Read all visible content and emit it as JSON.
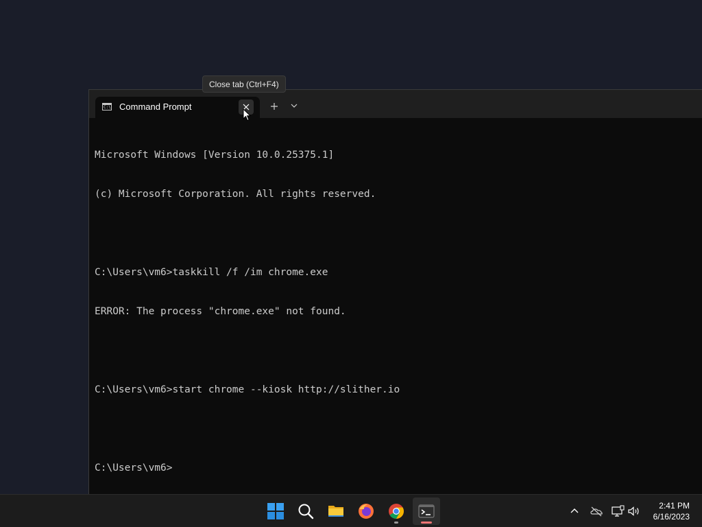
{
  "window": {
    "tab_title": "Command Prompt",
    "tab_icon": "cmd-icon",
    "close_tab_icon": "close-icon",
    "new_tab_icon": "plus-icon",
    "dropdown_icon": "chevron-down-icon"
  },
  "tooltip": {
    "text": "Close tab (Ctrl+F4)"
  },
  "console": {
    "lines": [
      "Microsoft Windows [Version 10.0.25375.1]",
      "(c) Microsoft Corporation. All rights reserved.",
      "",
      "C:\\Users\\vm6>taskkill /f /im chrome.exe",
      "ERROR: The process \"chrome.exe\" not found.",
      "",
      "C:\\Users\\vm6>start chrome --kiosk http://slither.io",
      "",
      "C:\\Users\\vm6>"
    ]
  },
  "taskbar": {
    "apps": [
      "start-icon",
      "search-icon",
      "file-explorer-icon",
      "firefox-icon",
      "chrome-icon",
      "terminal-icon"
    ],
    "tray": [
      "chevron-up-icon",
      "onedrive-icon",
      "network-icon",
      "volume-icon"
    ],
    "time": "2:41 PM",
    "date": "6/16/2023"
  },
  "colors": {
    "desktop": "#1a1d29",
    "console_bg": "#0c0c0c",
    "console_text": "#cccccc",
    "accent": "#0078d4"
  }
}
